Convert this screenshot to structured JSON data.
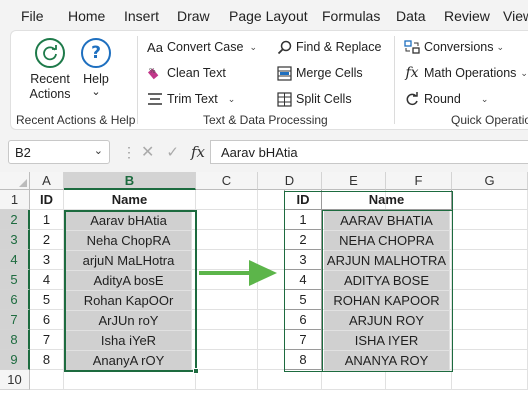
{
  "ribbon_tabs": [
    "File",
    "Home",
    "Insert",
    "Draw",
    "Page Layout",
    "Formulas",
    "Data",
    "Review",
    "View"
  ],
  "groups": {
    "recent": {
      "label": "Recent Actions & Help",
      "recent_actions_line1": "Recent",
      "recent_actions_line2": "Actions",
      "help_label": "Help",
      "help_caret": "⌄"
    },
    "text": {
      "label": "Text & Data Processing",
      "convert_case": "Convert Case",
      "clean_text": "Clean Text",
      "trim_text": "Trim Text",
      "find_replace": "Find & Replace",
      "merge_cells": "Merge Cells",
      "split_cells": "Split Cells"
    },
    "quick": {
      "label": "Quick Operatio",
      "conversions": "Conversions",
      "math_operations": "Math Operations",
      "round": "Round"
    }
  },
  "formula_bar": {
    "name_box": "B2",
    "formula": "Aarav bHAtia"
  },
  "columns": [
    "A",
    "B",
    "C",
    "D",
    "E",
    "F",
    "G"
  ],
  "rows": [
    "1",
    "2",
    "3",
    "4",
    "5",
    "6",
    "7",
    "8",
    "9",
    "10"
  ],
  "table_left": {
    "headers": [
      "ID",
      "Name"
    ],
    "rows": [
      [
        "1",
        "Aarav bHAtia"
      ],
      [
        "2",
        "Neha ChopRA"
      ],
      [
        "3",
        "arjuN MaLHotra"
      ],
      [
        "4",
        "AdityA bosE"
      ],
      [
        "5",
        "Rohan KapOOr"
      ],
      [
        "6",
        "ArJUn roY"
      ],
      [
        "7",
        "Isha iYeR"
      ],
      [
        "8",
        "AnanyA rOY"
      ]
    ]
  },
  "table_right": {
    "headers": [
      "ID",
      "Name"
    ],
    "rows": [
      [
        "1",
        "AARAV BHATIA"
      ],
      [
        "2",
        "NEHA CHOPRA"
      ],
      [
        "3",
        "ARJUN MALHOTRA"
      ],
      [
        "4",
        "ADITYA BOSE"
      ],
      [
        "5",
        "ROHAN KAPOOR"
      ],
      [
        "6",
        "ARJUN ROY"
      ],
      [
        "7",
        "ISHA IYER"
      ],
      [
        "8",
        "ANANYA ROY"
      ]
    ]
  },
  "colors": {
    "accent_green": "#1d6b3f",
    "arrow_green": "#5cb54a",
    "cell_gray": "#d0d0d0"
  }
}
